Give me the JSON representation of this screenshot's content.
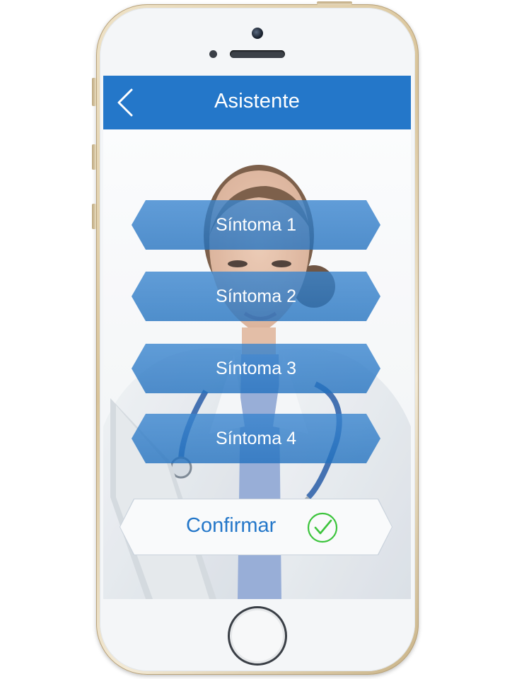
{
  "header": {
    "title": "Asistente",
    "back_icon": "chevron-left-icon"
  },
  "symptoms": [
    {
      "label": "Síntoma 1"
    },
    {
      "label": "Síntoma 2"
    },
    {
      "label": "Síntoma 3"
    },
    {
      "label": "Síntoma 4"
    }
  ],
  "confirm": {
    "label": "Confirmar",
    "icon": "check-circle-icon",
    "icon_color": "#3cc43c"
  },
  "colors": {
    "accent": "#2477c9",
    "button_fill": "#2477c9",
    "title_text": "#ffffff"
  },
  "background_image": "doctor-with-stethoscope-photo"
}
